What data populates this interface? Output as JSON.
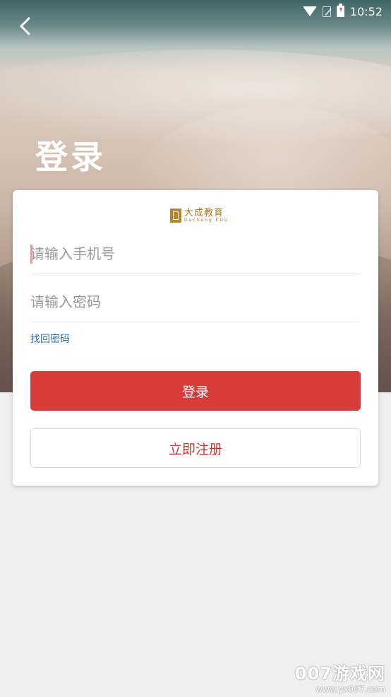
{
  "status_bar": {
    "time": "10:52"
  },
  "page": {
    "title": "登录"
  },
  "logo": {
    "name_cn": "大成教育",
    "name_en": "Dacheng EDU"
  },
  "form": {
    "phone_placeholder": "请输入手机号",
    "password_placeholder": "请输入密码",
    "forgot_label": "找回密码",
    "login_label": "登录",
    "register_label": "立即注册"
  },
  "watermark": {
    "main": "007游戏网",
    "url": "www.yx007.com"
  },
  "colors": {
    "primary": "#d83c38",
    "link": "#2a6fb4",
    "logo": "#b7862a",
    "background": "#efefef"
  }
}
